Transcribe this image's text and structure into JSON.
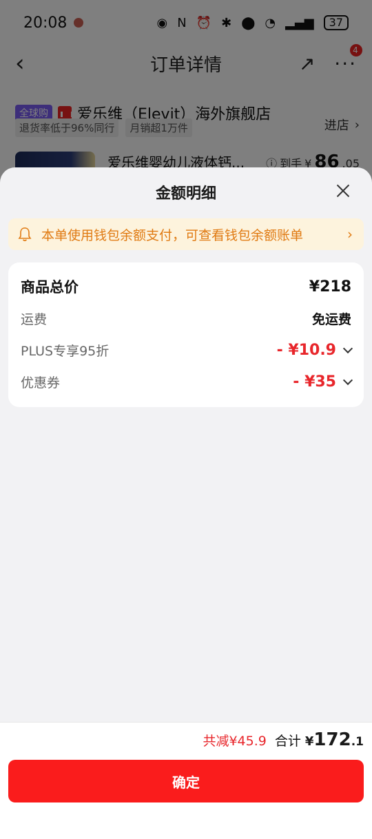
{
  "status_bar": {
    "time": "20:08",
    "battery": "37"
  },
  "nav": {
    "back_icon": "chevron-left-icon",
    "title": "订单详情",
    "badge": "4"
  },
  "store": {
    "global_tag": "全球购",
    "name": "爱乐维（Elevit）海外旗舰店",
    "enter_label": "进店",
    "tags": [
      "退货率低于96%同行",
      "月销超1万件"
    ]
  },
  "product": {
    "title": "爱乐维婴幼儿液体钙...",
    "price_prefix": "到手",
    "price_symbol": "¥",
    "price_int": "86",
    "price_dec": ".05"
  },
  "sheet": {
    "title": "金额明细",
    "notice": "本单使用钱包余额支付，可查看钱包余额账单",
    "rows": [
      {
        "label": "商品总价",
        "value": "¥218"
      },
      {
        "label": "运费",
        "value": "免运费"
      },
      {
        "label": "PLUS专享95折",
        "value": "- ¥10.9"
      },
      {
        "label": "优惠券",
        "value": "- ¥35"
      }
    ]
  },
  "footer": {
    "reduced": "共减¥45.9",
    "total_label": "合计",
    "total_yen": "¥",
    "total_int": "172",
    "total_dec": ".1",
    "confirm_label": "确定"
  },
  "colors": {
    "accent_red": "#fa1c1c",
    "discount_red": "#e8262b",
    "notice_bg": "#fdf3dd",
    "notice_text": "#e07a12",
    "global_tag": "#7b5cf5"
  }
}
